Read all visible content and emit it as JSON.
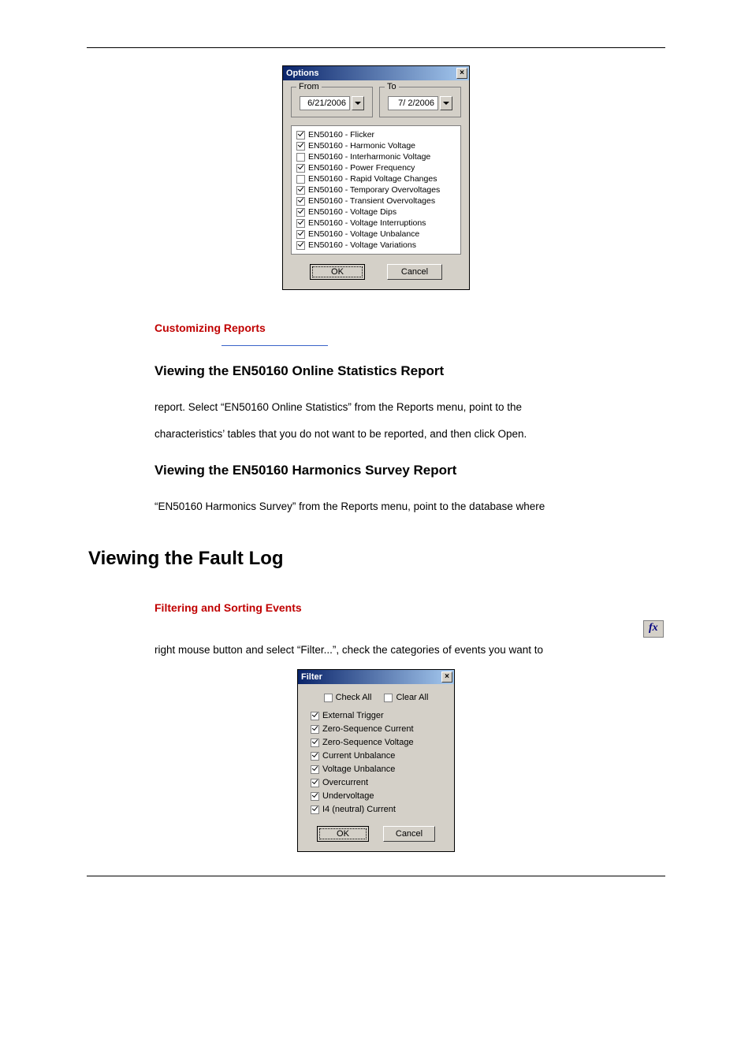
{
  "dialog1": {
    "title": "Options",
    "from_legend": "From",
    "to_legend": "To",
    "from_value": "6/21/2006",
    "to_value": "7/ 2/2006",
    "items": [
      {
        "label": "EN50160 - Flicker",
        "checked": true
      },
      {
        "label": "EN50160 - Harmonic Voltage",
        "checked": true
      },
      {
        "label": "EN50160 - Interharmonic Voltage",
        "checked": false
      },
      {
        "label": "EN50160 - Power Frequency",
        "checked": true
      },
      {
        "label": "EN50160 - Rapid Voltage Changes",
        "checked": false
      },
      {
        "label": "EN50160 - Temporary Overvoltages",
        "checked": true
      },
      {
        "label": "EN50160 - Transient Overvoltages",
        "checked": true
      },
      {
        "label": "EN50160 - Voltage Dips",
        "checked": true
      },
      {
        "label": "EN50160 - Voltage Interruptions",
        "checked": true
      },
      {
        "label": "EN50160 - Voltage Unbalance",
        "checked": true
      },
      {
        "label": "EN50160 - Voltage Variations",
        "checked": true
      }
    ],
    "ok": "OK",
    "cancel": "Cancel"
  },
  "doc": {
    "h_custom": "Customizing Reports",
    "h_online": "Viewing the EN50160 Online Statistics Report",
    "p_online_1": "report. Select “EN50160 Online Statistics” from the Reports menu, point to the",
    "p_online_2": "characteristics’ tables that you do not want to be reported, and then click Open.",
    "h_harm": "Viewing the EN50160 Harmonics Survey Report",
    "p_harm": "“EN50160 Harmonics Survey” from the Reports menu, point to the database where",
    "h_fault": "Viewing the Fault Log",
    "h_filter": "Filtering and Sorting Events",
    "p_filter": "right mouse button and select “Filter...”, check the categories of events you want to",
    "fx_label": "fx"
  },
  "dialog2": {
    "title": "Filter",
    "check_all": "Check All",
    "clear_all": "Clear All",
    "items": [
      {
        "label": "External Trigger",
        "checked": true
      },
      {
        "label": "Zero-Sequence Current",
        "checked": true
      },
      {
        "label": "Zero-Sequence Voltage",
        "checked": true
      },
      {
        "label": "Current Unbalance",
        "checked": true
      },
      {
        "label": "Voltage Unbalance",
        "checked": true
      },
      {
        "label": "Overcurrent",
        "checked": true
      },
      {
        "label": "Undervoltage",
        "checked": true
      },
      {
        "label": "I4 (neutral) Current",
        "checked": true
      }
    ],
    "ok": "OK",
    "cancel": "Cancel"
  }
}
